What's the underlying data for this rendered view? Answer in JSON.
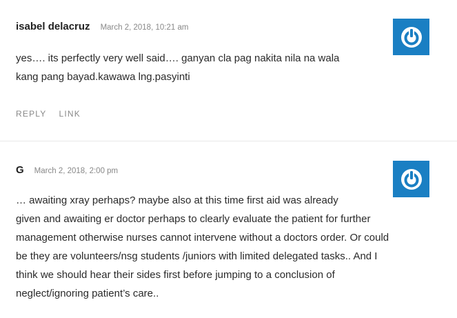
{
  "comments": [
    {
      "author": "isabel delacruz",
      "date": "March 2, 2018, 10:21 am",
      "lines": [
        "yes…. its perfectly very well said…. ganyan cla pag nakita nila na wala",
        "kang pang bayad.kawawa lng.pasyinti"
      ],
      "reply_label": "REPLY",
      "link_label": "LINK"
    },
    {
      "author": "G",
      "date": "March 2, 2018, 2:00 pm",
      "lines": [
        "… awaiting xray perhaps? maybe also at this time first aid was already",
        "given and awaiting er doctor perhaps to clearly evaluate the patient for further",
        "management otherwise nurses cannot intervene without a doctors order. Or could",
        "be they are volunteers/nsg students /juniors with limited delegated tasks.. And I",
        "think we should hear their sides first before jumping to a conclusion of",
        "neglect/ignoring patient’s care.."
      ]
    }
  ],
  "colors": {
    "avatar_bg": "#1a7fc3",
    "avatar_fg": "#ffffff"
  },
  "icons": {
    "avatar": "power-button-icon"
  }
}
